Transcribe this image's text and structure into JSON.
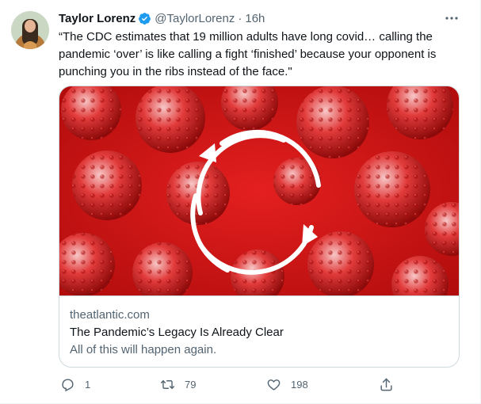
{
  "tweet": {
    "author": {
      "name": "Taylor Lorenz",
      "handle": "@TaylorLorenz",
      "time": "16h"
    },
    "separator": "·",
    "text": "“The CDC estimates that 19 million adults have long covid… calling the pandemic ‘over’ is like calling a fight ‘finished’ because your opponent is punching you in the ribs instead of the face.\"",
    "card": {
      "domain": "theatlantic.com",
      "title": "The Pandemic’s Legacy Is Already Clear",
      "description": "All of this will happen again."
    },
    "actions": {
      "replies": "1",
      "retweets": "79",
      "likes": "198"
    }
  },
  "icons": {
    "verified": "verified-badge-icon",
    "more": "more-options-icon",
    "reply": "reply-icon",
    "retweet": "retweet-icon",
    "like": "heart-icon",
    "share": "share-icon"
  },
  "colors": {
    "verified_blue": "#1d9bf0",
    "secondary_text": "#536471",
    "border": "#cfd9de",
    "card_red": "#d81e1e"
  }
}
